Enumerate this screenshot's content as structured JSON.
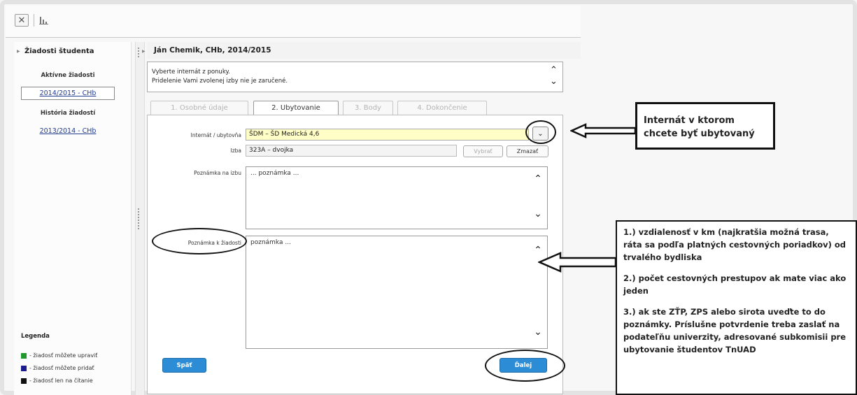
{
  "toolbar": {
    "close_icon": "✕",
    "chart_icon": "chart-icon"
  },
  "left": {
    "title": "Žiadosti študenta",
    "active_heading": "Aktívne žiadosti",
    "active_item": "2014/2015 - CHb",
    "history_heading": "História žiadostí",
    "history_item": "2013/2014 - CHb",
    "legend_title": "Legenda",
    "legend": [
      {
        "color": "#1f9a2a",
        "text": "- žiadosť môžete upraviť"
      },
      {
        "color": "#1c1c8c",
        "text": "- žiadosť môžete pridať"
      },
      {
        "color": "#111111",
        "text": "- žiadosť len na čítanie"
      }
    ]
  },
  "right": {
    "title": "Ján Chemik, CHb, 2014/2015",
    "info_line1": "Vyberte internát z ponuky.",
    "info_line2": "Pridelenie Vami zvolenej izby nie je zaručené.",
    "tabs": [
      "1. Osobné údaje",
      "2. Ubytovanie",
      "3. Body",
      "4. Dokončenie"
    ],
    "internat_label": "Internát / ubytovňa",
    "internat_value": "ŠDM – ŠD Medická 4,6",
    "izba_label": "Izba",
    "izba_value": "323A – dvojka",
    "vybrat_label": "Vybrať",
    "zmazat_label": "Zmazať",
    "note_izba_label": "Poznámka na izbu",
    "note_izba_value": "... poznámka ...",
    "note_ziadost_label": "Poznámka k žiadosti",
    "note_ziadost_value": "poznámka ...",
    "back_label": "Späť",
    "next_label": "Ďalej"
  },
  "annotations": {
    "box1": "Internát v ktorom chcete byť ubytovaný",
    "box2": [
      "1.) vzdialenosť v km (najkratšia možná trasa, ráta sa podľa platných cestovných poriadkov) od trvalého bydliska",
      "2.) počet cestovných prestupov ak mate viac ako jeden",
      "3.) ak ste ZŤP, ZPS  alebo sirota uveďte to do poznámky. Príslušne potvrdenie treba zaslať na podateľňu univerzity, adresované subkomisii pre ubytovanie študentov TnUAD"
    ]
  }
}
